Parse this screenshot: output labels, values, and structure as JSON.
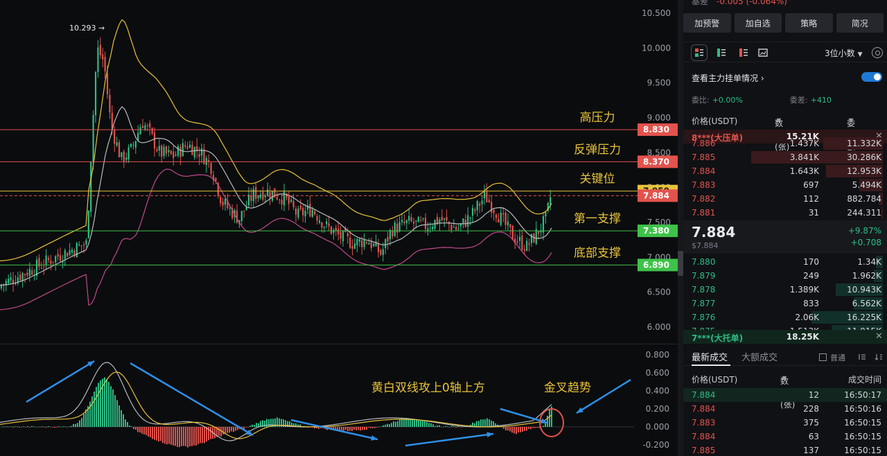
{
  "chart": {
    "price_ticks": [
      "10.500",
      "10.000",
      "9.500",
      "9.000",
      "8.500",
      "8.000",
      "7.500",
      "7.000",
      "6.500",
      "6.000"
    ],
    "macd_ticks": [
      "0.800",
      "0.600",
      "0.400",
      "0.200",
      "0.000",
      "-0.200"
    ],
    "high_label": "10.293",
    "levels": [
      {
        "price": 8.83,
        "label": "8.830",
        "name": "高压力",
        "color": "#e2534d"
      },
      {
        "price": 8.37,
        "label": "8.370",
        "name": "反弹压力",
        "color": "#e2534d"
      },
      {
        "price": 7.95,
        "label": "7.950",
        "name": "关键位",
        "color": "#e8c33a"
      },
      {
        "price": 7.38,
        "label": "7.380",
        "name": "第一支撑",
        "color": "#3fc24a"
      },
      {
        "price": 6.89,
        "label": "6.890",
        "name": "底部支撑",
        "color": "#3fc24a"
      }
    ],
    "current_price_label": "7.884",
    "annotations": {
      "macd_cross": "黄白双线攻上0轴上方",
      "golden_cross": "金叉趋势"
    },
    "colors": {
      "up": "#2dbd85",
      "down": "#e2534d",
      "ma_white": "#b9bcc2",
      "boll_yellow": "#e8c33a",
      "boll_pink": "#c04a8e",
      "arrow": "#2e8fe6"
    }
  },
  "panel": {
    "top_cut": {
      "label": "基差",
      "value": "-0.005 (-0.064%)"
    },
    "buttons": [
      "加预警",
      "加自选",
      "策略",
      "简况"
    ],
    "decimals": "3位小数",
    "view_main": "查看主力挂单情况",
    "ratio": {
      "label1": "委比:",
      "value1": "+0.00%",
      "label2": "委差:",
      "value2": "+410"
    },
    "ob_head": {
      "price": "价格(USDT)",
      "qty": "数量 (张)",
      "amount": "委托额"
    },
    "big_ask": {
      "label": "8***(大压单)",
      "qty": "15.21K"
    },
    "asks": [
      {
        "price": "7.886",
        "qty": "1.437K",
        "amount": "11.332K",
        "depth": 0.45
      },
      {
        "price": "7.885",
        "qty": "3.841K",
        "amount": "30.286K",
        "depth": 1.0
      },
      {
        "price": "7.884",
        "qty": "1.643K",
        "amount": "12.953K",
        "depth": 0.43
      },
      {
        "price": "7.883",
        "qty": "697",
        "amount": "5.494K",
        "depth": 0.18
      },
      {
        "price": "7.882",
        "qty": "112",
        "amount": "882.784",
        "depth": 0.03
      },
      {
        "price": "7.881",
        "qty": "31",
        "amount": "244.311",
        "depth": 0.01
      }
    ],
    "mid": {
      "price": "7.884",
      "sub": "$7.884",
      "pct": "+9.87%",
      "chg": "+0.708"
    },
    "bids": [
      {
        "price": "7.880",
        "qty": "170",
        "amount": "1.34K",
        "depth": 0.05
      },
      {
        "price": "7.879",
        "qty": "249",
        "amount": "1.962K",
        "depth": 0.07
      },
      {
        "price": "7.878",
        "qty": "1.389K",
        "amount": "10.943K",
        "depth": 0.36
      },
      {
        "price": "7.877",
        "qty": "833",
        "amount": "6.562K",
        "depth": 0.22
      },
      {
        "price": "7.876",
        "qty": "2.06K",
        "amount": "16.225K",
        "depth": 0.54
      },
      {
        "price": "7.875",
        "qty": "1.513K",
        "amount": "11.915K",
        "depth": 0.39
      }
    ],
    "big_bid": {
      "label": "7***(大托单)",
      "qty": "18.25K"
    },
    "tabs": {
      "latest": "最新成交",
      "large": "大额成交",
      "normal": "普通"
    },
    "tr_head": {
      "price": "价格(USDT)",
      "qty": "数量(张)",
      "time": "成交时间"
    },
    "trades": [
      {
        "price": "7.884",
        "qty": "12",
        "time": "16:50:17",
        "side": "buy"
      },
      {
        "price": "7.884",
        "qty": "228",
        "time": "16:50:16",
        "side": "sell"
      },
      {
        "price": "7.883",
        "qty": "375",
        "time": "16:50:15",
        "side": "sell"
      },
      {
        "price": "7.884",
        "qty": "63",
        "time": "16:50:15",
        "side": "sell"
      },
      {
        "price": "7.885",
        "qty": "137",
        "time": "16:50:15",
        "side": "sell"
      }
    ]
  }
}
